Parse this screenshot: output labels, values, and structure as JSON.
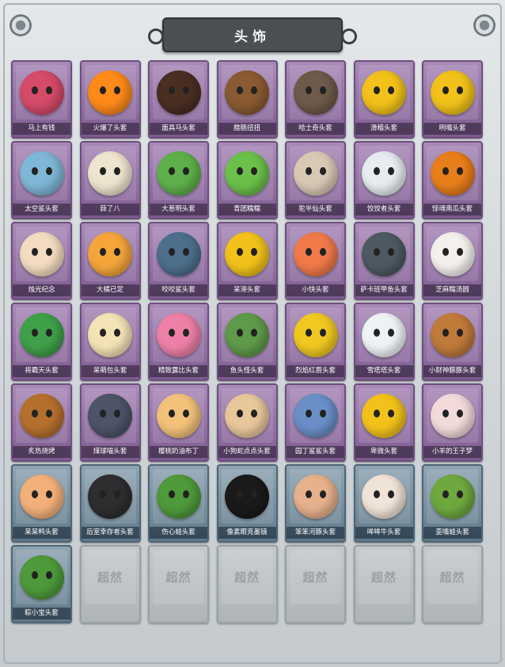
{
  "panel_title": "头饰",
  "watermark": "超然",
  "items": [
    {
      "label": "马上有钱",
      "rarity": "purple",
      "color": "#d64a6a"
    },
    {
      "label": "火爆了头套",
      "rarity": "purple",
      "color": "#ff8a1a"
    },
    {
      "label": "面具马头套",
      "rarity": "purple",
      "color": "#4a2e22"
    },
    {
      "label": "腊肠扭扭",
      "rarity": "purple",
      "color": "#8a5a32"
    },
    {
      "label": "哈士奇头套",
      "rarity": "purple",
      "color": "#6d5a4a"
    },
    {
      "label": "滑稽头套",
      "rarity": "purple",
      "color": "#f2c21a"
    },
    {
      "label": "咧嘴头套",
      "rarity": "purple",
      "color": "#f2c21a"
    },
    {
      "label": "太空鲨头套",
      "rarity": "purple",
      "color": "#7fb7d6"
    },
    {
      "label": "蒜了八",
      "rarity": "purple",
      "color": "#efe4cf"
    },
    {
      "label": "大葱明头套",
      "rarity": "purple",
      "color": "#5fb04a"
    },
    {
      "label": "青团糯糯",
      "rarity": "purple",
      "color": "#6cc04a"
    },
    {
      "label": "驼半仙头套",
      "rarity": "purple",
      "color": "#d8c9b5"
    },
    {
      "label": "饺饺者头套",
      "rarity": "purple",
      "color": "#e6ecef"
    },
    {
      "label": "惊魂南瓜头套",
      "rarity": "purple",
      "color": "#e87e1a"
    },
    {
      "label": "烛光纪念",
      "rarity": "purple",
      "color": "#f3dcc0"
    },
    {
      "label": "大橘已定",
      "rarity": "purple",
      "color": "#f5a53a"
    },
    {
      "label": "咬咬鲨头套",
      "rarity": "purple",
      "color": "#4d6f8c"
    },
    {
      "label": "呆滞头套",
      "rarity": "purple",
      "color": "#f2c21a"
    },
    {
      "label": "小快头套",
      "rarity": "purple",
      "color": "#f07a4a"
    },
    {
      "label": "萨卡班甲鱼头套",
      "rarity": "purple",
      "color": "#4e5a62"
    },
    {
      "label": "芝麻糯汤圆",
      "rarity": "purple",
      "color": "#f4f0ee"
    },
    {
      "label": "将霸天头套",
      "rarity": "purple",
      "color": "#3fa04a"
    },
    {
      "label": "呆萌包头套",
      "rarity": "purple",
      "color": "#f3e3b5"
    },
    {
      "label": "精致露比头套",
      "rarity": "purple",
      "color": "#ee80a8"
    },
    {
      "label": "鱼头怪头套",
      "rarity": "purple",
      "color": "#5f9a4a"
    },
    {
      "label": "烈焰红唇头套",
      "rarity": "purple",
      "color": "#f0c820"
    },
    {
      "label": "雪塔塔头套",
      "rarity": "purple",
      "color": "#eef2f5"
    },
    {
      "label": "小财神豚豚头套",
      "rarity": "purple",
      "color": "#c07a3a"
    },
    {
      "label": "炙热烧烤",
      "rarity": "purple",
      "color": "#b5702e"
    },
    {
      "label": "煤球喵头套",
      "rarity": "purple",
      "color": "#4d5468"
    },
    {
      "label": "樱桃奶油布丁",
      "rarity": "purple",
      "color": "#f3c27a"
    },
    {
      "label": "小狗蛇点点头套",
      "rarity": "purple",
      "color": "#e8c79a"
    },
    {
      "label": "园丁鲨鲨头套",
      "rarity": "purple",
      "color": "#6a8fc8"
    },
    {
      "label": "卑微头套",
      "rarity": "purple",
      "color": "#f2c21a"
    },
    {
      "label": "小羊的王子梦",
      "rarity": "purple",
      "color": "#f2dada"
    },
    {
      "label": "呆呆鸭头套",
      "rarity": "blue",
      "color": "#f3b07a"
    },
    {
      "label": "后室幸存者头套",
      "rarity": "blue",
      "color": "#2e2e30"
    },
    {
      "label": "伤心蛙头套",
      "rarity": "blue",
      "color": "#4f9a3a"
    },
    {
      "label": "像素眼克墨镜",
      "rarity": "blue",
      "color": "#1a1a1a"
    },
    {
      "label": "笨笨河豚头套",
      "rarity": "blue",
      "color": "#e6b18c"
    },
    {
      "label": "哞哞牛头套",
      "rarity": "blue",
      "color": "#f0e3d8"
    },
    {
      "label": "歪嘴蛙头套",
      "rarity": "blue",
      "color": "#6fa83f"
    },
    {
      "label": "粽小宝头套",
      "rarity": "blue",
      "color": "#4e9a3a"
    },
    {
      "label": "",
      "rarity": "empty",
      "color": ""
    },
    {
      "label": "",
      "rarity": "empty",
      "color": ""
    },
    {
      "label": "",
      "rarity": "empty",
      "color": ""
    },
    {
      "label": "",
      "rarity": "empty",
      "color": ""
    },
    {
      "label": "",
      "rarity": "empty",
      "color": ""
    },
    {
      "label": "",
      "rarity": "empty",
      "color": ""
    }
  ]
}
